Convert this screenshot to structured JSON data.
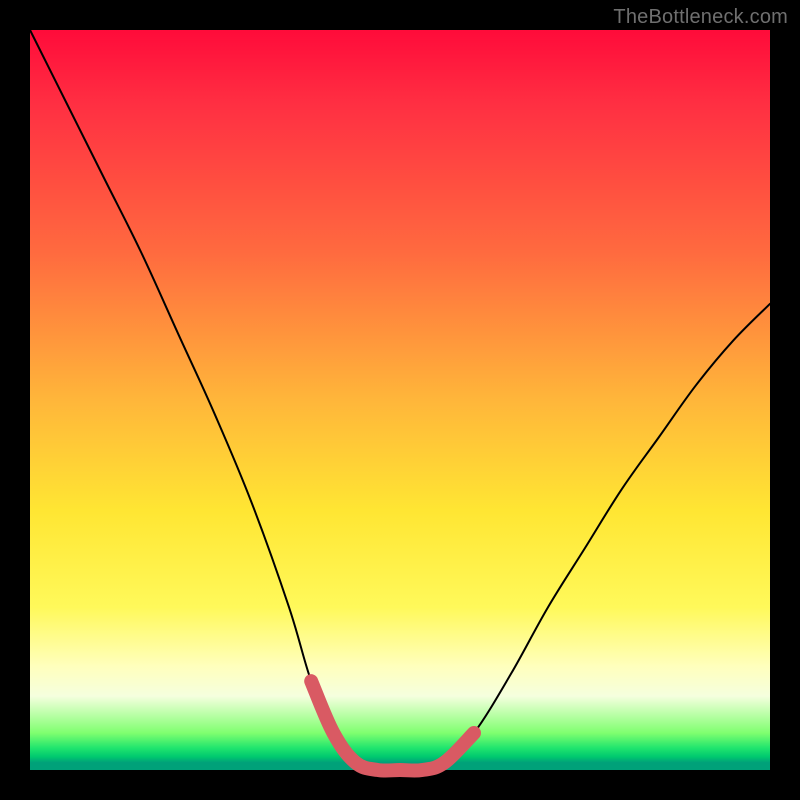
{
  "watermark": "TheBottleneck.com",
  "chart_data": {
    "type": "line",
    "title": "",
    "xlabel": "",
    "ylabel": "",
    "xlim": [
      0,
      100
    ],
    "ylim": [
      0,
      100
    ],
    "series": [
      {
        "name": "bottleneck-curve",
        "x": [
          0,
          5,
          10,
          15,
          20,
          25,
          30,
          35,
          38,
          41,
          44,
          47,
          50,
          53,
          56,
          60,
          65,
          70,
          75,
          80,
          85,
          90,
          95,
          100
        ],
        "values": [
          100,
          90,
          80,
          70,
          59,
          48,
          36,
          22,
          12,
          5,
          1,
          0,
          0,
          0,
          1,
          5,
          13,
          22,
          30,
          38,
          45,
          52,
          58,
          63
        ]
      },
      {
        "name": "sweet-spot-highlight",
        "x": [
          38,
          41,
          44,
          47,
          50,
          53,
          56,
          60
        ],
        "values": [
          12,
          5,
          1,
          0,
          0,
          0,
          1,
          5
        ]
      }
    ],
    "colors": {
      "curve": "#000000",
      "highlight": "#d95a63"
    }
  }
}
